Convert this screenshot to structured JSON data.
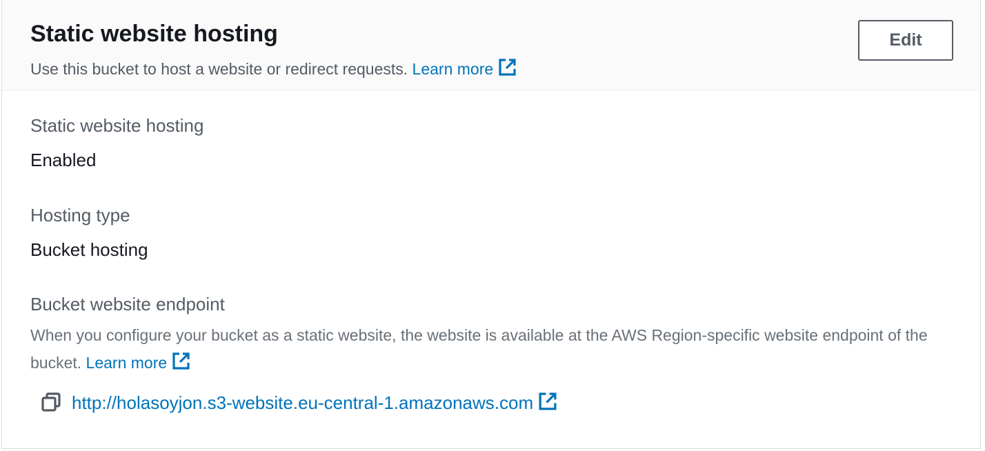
{
  "header": {
    "title": "Static website hosting",
    "subtitle": "Use this bucket to host a website or redirect requests.",
    "learn_more": "Learn more",
    "edit_label": "Edit"
  },
  "fields": {
    "hosting": {
      "label": "Static website hosting",
      "value": "Enabled"
    },
    "hosting_type": {
      "label": "Hosting type",
      "value": "Bucket hosting"
    },
    "endpoint": {
      "label": "Bucket website endpoint",
      "description": "When you configure your bucket as a static website, the website is available at the AWS Region-specific website endpoint of the bucket.",
      "learn_more": "Learn more",
      "url": "http://holasoyjon.s3-website.eu-central-1.amazonaws.com"
    }
  },
  "icons": {
    "external": "external-link-icon",
    "copy": "copy-icon"
  },
  "colors": {
    "link": "#0073bb",
    "text_primary": "#16191f",
    "text_secondary": "#545b64",
    "header_bg": "#fafafa"
  }
}
